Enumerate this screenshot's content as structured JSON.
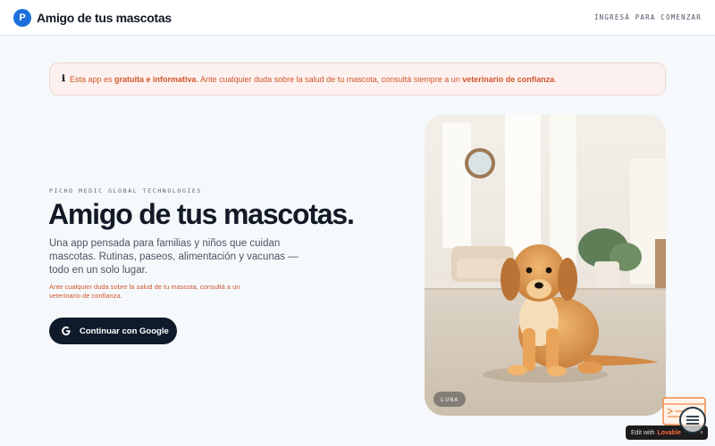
{
  "header": {
    "logo_letter": "P",
    "brand_name": "Amigo de tus mascotas",
    "login_link": "INGRESÁ PARA COMENZAR"
  },
  "notice": {
    "icon": "info-icon",
    "text_1": "Esta app es ",
    "bold_1": "gratuita e informativa",
    "text_2": ". Ante cualquier duda sobre la salud de tu mascota, consultá siempre a un ",
    "bold_2": "veterinario de confianza",
    "text_3": "."
  },
  "hero": {
    "eyebrow": "PICHO MEDIC GLOBAL TECHNOLOGIES",
    "title": "Amigo de tus mascotas.",
    "description": "Una app pensada para familias y niños que cuidan mascotas. Rutinas, paseos, alimentación y vacunas — todo en un solo lugar.",
    "warning": "Ante cualquier duda sobre la salud de tu mascota, consultá a un veterinario de confianza.",
    "google_button": "Continuar con Google",
    "google_icon": "google-g-icon"
  },
  "photo": {
    "pet_name": "LUNA"
  },
  "edit_badge": {
    "prefix": "Edit with",
    "brand": "Lovable",
    "close": "×"
  },
  "colors": {
    "accent": "#1b6fdc",
    "dark": "#0f1b2a",
    "warning": "#d2552e",
    "notice_bg": "#fcf1ee"
  }
}
